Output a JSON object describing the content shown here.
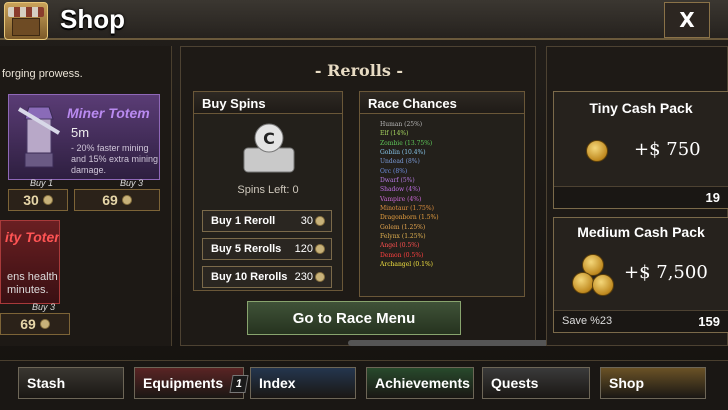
{
  "header": {
    "title": "Shop",
    "close_label": "X"
  },
  "left": {
    "desc_fragment": "forging prowess.",
    "miner_totem": {
      "name": "Miner Totem",
      "time": "5m",
      "desc": "- 20% faster mining and 15% extra mining damage.",
      "buy1_label": "Buy 1",
      "buy3_label": "Buy 3",
      "price1": "30",
      "price3": "69"
    },
    "second_totem": {
      "name": "ity Totem",
      "desc_line1": "ens health",
      "desc_line2": "minutes.",
      "buy3_label": "Buy 3",
      "price3": "69"
    }
  },
  "rerolls": {
    "title": "- Rerolls -",
    "buy_spins_title": "Buy Spins",
    "spin_icon_letter": "C",
    "spins_left": "Spins Left: 0",
    "buttons": [
      {
        "label": "Buy 1 Reroll",
        "cost": "30"
      },
      {
        "label": "Buy 5 Rerolls",
        "cost": "120"
      },
      {
        "label": "Buy 10 Rerolls",
        "cost": "230"
      }
    ],
    "race_chances_title": "Race Chances",
    "races": [
      {
        "text": "Human (25%)",
        "color": "#b9b9b9"
      },
      {
        "text": "Elf (14%)",
        "color": "#a8d860"
      },
      {
        "text": "Zombie (13.75%)",
        "color": "#5fc95a"
      },
      {
        "text": "Goblin (10.4%)",
        "color": "#86c4e8"
      },
      {
        "text": "Undead (8%)",
        "color": "#7a9ad6"
      },
      {
        "text": "Orc (8%)",
        "color": "#6f8fe0"
      },
      {
        "text": "Dwarf (5%)",
        "color": "#b47ae0"
      },
      {
        "text": "Shadow (4%)",
        "color": "#c070e8"
      },
      {
        "text": "Vampire (4%)",
        "color": "#cc6ad8"
      },
      {
        "text": "Minotaur (1.75%)",
        "color": "#e09040"
      },
      {
        "text": "Dragonborn (1.5%)",
        "color": "#e8a040"
      },
      {
        "text": "Golem (1.25%)",
        "color": "#e8a850"
      },
      {
        "text": "Felynx (1.25%)",
        "color": "#e0b050"
      },
      {
        "text": "Angel (0.5%)",
        "color": "#ff5050"
      },
      {
        "text": "Demon (0.5%)",
        "color": "#ff4040"
      },
      {
        "text": "Archangel (0.1%)",
        "color": "#f0e040"
      }
    ],
    "goto_label": "Go to Race Menu"
  },
  "cash": {
    "tiny": {
      "name": "Tiny Cash Pack",
      "amount": "+$ 750",
      "price": "19"
    },
    "medium": {
      "name": "Medium Cash Pack",
      "amount": "+$ 7,500",
      "save": "Save %23",
      "price": "159"
    }
  },
  "nav": [
    {
      "label": "Stash",
      "color": "#3a3731"
    },
    {
      "label": "Equipments",
      "color": "#5a2424",
      "badge": "1"
    },
    {
      "label": "Index",
      "color": "#24364e"
    },
    {
      "label": "Achievements",
      "color": "#284a2c"
    },
    {
      "label": "Quests",
      "color": "#3a3a3a"
    },
    {
      "label": "Shop",
      "color": "#6a5226"
    }
  ]
}
